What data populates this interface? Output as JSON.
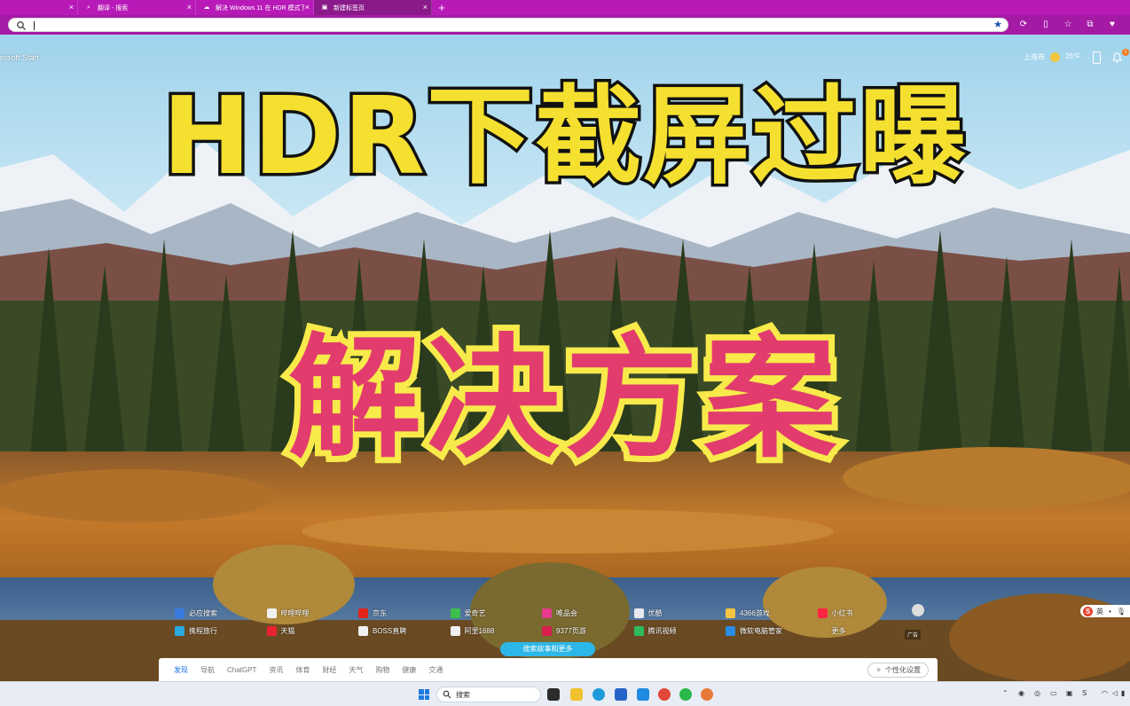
{
  "browser": {
    "tabs": [
      {
        "label": "",
        "icon": "blank-page-icon",
        "active": false
      },
      {
        "label": "翻译 - 搜索",
        "icon": "search-icon",
        "active": false
      },
      {
        "label": "解决 Windows 11 在 HDR 模式下...",
        "icon": "cloud-icon",
        "active": false
      },
      {
        "label": "新建标签页",
        "icon": "new-tab-page-icon",
        "active": true
      }
    ],
    "new_tab_label": "+",
    "address_value": "",
    "colors": {
      "tabbar": "#b81ab8",
      "address_row": "#a51aa5"
    }
  },
  "page": {
    "brand": "rosoft Start",
    "weather": {
      "city": "上海市",
      "temperature": "26°F"
    },
    "notification_count": "1",
    "overlay": {
      "title_top": "HDR下截屏过曝",
      "title_bottom": "解决方案",
      "colors": {
        "top_fill": "#f5e030",
        "top_stroke": "#111111",
        "bottom_fill": "#e23c6e",
        "bottom_stroke": "#f8ea4a"
      }
    },
    "quick_links": [
      {
        "label": "必应搜索",
        "icon": "bing-search-icon",
        "color": "#3a7be0"
      },
      {
        "label": "哔哩哔哩",
        "icon": "bilibili-icon",
        "color": "#f0f0f0"
      },
      {
        "label": "京东",
        "icon": "jd-icon",
        "color": "#e1251b"
      },
      {
        "label": "爱奇艺",
        "icon": "iqiyi-icon",
        "color": "#3cc04b"
      },
      {
        "label": "唯品会",
        "icon": "vip-icon",
        "color": "#e63b8f"
      },
      {
        "label": "优酷",
        "icon": "youku-icon",
        "color": "#e8e8f0"
      },
      {
        "label": "4366游戏",
        "icon": "game-icon",
        "color": "#f5c542"
      },
      {
        "label": "小红书",
        "icon": "xiaohongshu-icon",
        "color": "#ff2442"
      },
      {
        "label": "携程旅行",
        "icon": "ctrip-icon",
        "color": "#2aa8e0"
      },
      {
        "label": "天猫",
        "icon": "tmall-icon",
        "color": "#e8222e"
      },
      {
        "label": "BOSS直聘",
        "icon": "boss-icon",
        "color": "#f0f0f0"
      },
      {
        "label": "阿里1688",
        "icon": "alibaba-icon",
        "color": "#f0f0f0"
      },
      {
        "label": "9377页游",
        "icon": "web-game-icon",
        "color": "#d81f4d"
      },
      {
        "label": "腾讯视频",
        "icon": "tencent-video-icon",
        "color": "#2dbb5d"
      },
      {
        "label": "微软电脑管家",
        "icon": "pc-manager-icon",
        "color": "#2b8ce8"
      },
      {
        "label": "更多",
        "icon": "more-list-icon",
        "color": "transparent"
      }
    ],
    "ad_label": "广告",
    "more_button": "搜索故事和更多",
    "feed_tabs": [
      "发现",
      "导航",
      "ChatGPT",
      "资讯",
      "体育",
      "财经",
      "天气",
      "购物",
      "健康",
      "交通"
    ],
    "personalize_label": "个性化设置",
    "ime_label": "英"
  },
  "taskbar": {
    "search_placeholder": "搜索"
  }
}
